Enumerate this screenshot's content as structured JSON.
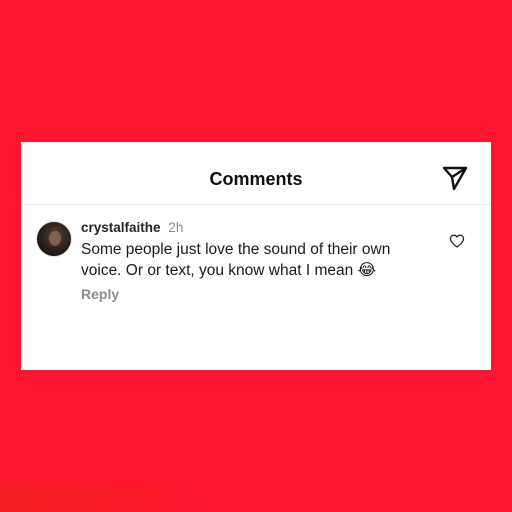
{
  "colors": {
    "background": "#ff1530",
    "card": "#ffffff",
    "username": "#262626",
    "secondary_text": "#8e8e8e"
  },
  "header": {
    "title": "Comments",
    "share_icon": "paper-plane-icon"
  },
  "comment": {
    "username": "crystalfaithe",
    "time": "2h",
    "text": "Some people just love the sound of their own voice. Or or text, you know what I mean",
    "emoji": "😂",
    "reply_label": "Reply",
    "like_icon": "heart-outline-icon",
    "avatar_icon": "user-avatar"
  }
}
